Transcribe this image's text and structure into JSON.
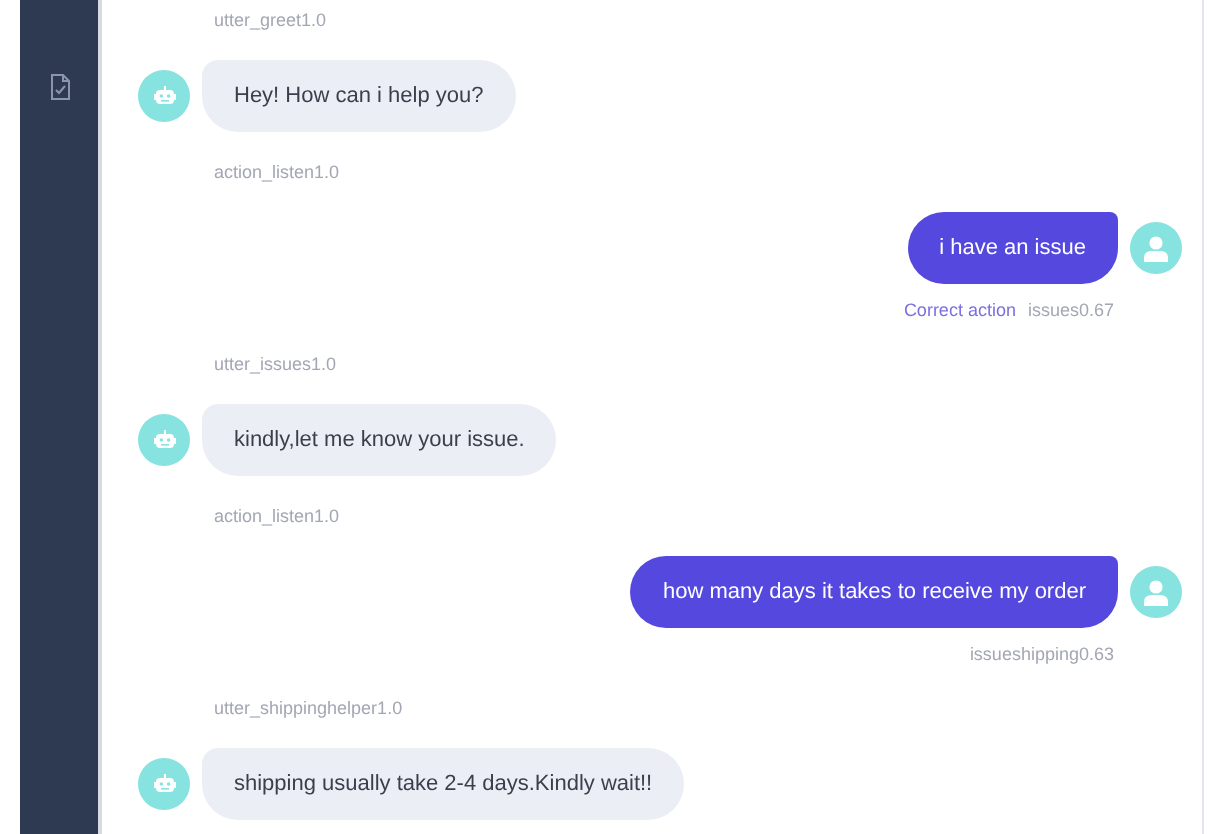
{
  "messages": [
    {
      "kind": "action",
      "text": "utter_greet1.0"
    },
    {
      "kind": "bot",
      "text": "Hey! How can i help you?"
    },
    {
      "kind": "action",
      "text": "action_listen1.0"
    },
    {
      "kind": "user",
      "text": "i have an issue",
      "link": "Correct action",
      "intent": "issues0.67"
    },
    {
      "kind": "action",
      "text": "utter_issues1.0"
    },
    {
      "kind": "bot",
      "text": "kindly,let me know your issue."
    },
    {
      "kind": "action",
      "text": "action_listen1.0"
    },
    {
      "kind": "user",
      "text": "how many days it takes to receive my order",
      "intent": "issueshipping0.63"
    },
    {
      "kind": "action",
      "text": "utter_shippinghelper1.0"
    },
    {
      "kind": "bot",
      "text": "shipping usually take 2-4 days.Kindly wait!!"
    }
  ]
}
